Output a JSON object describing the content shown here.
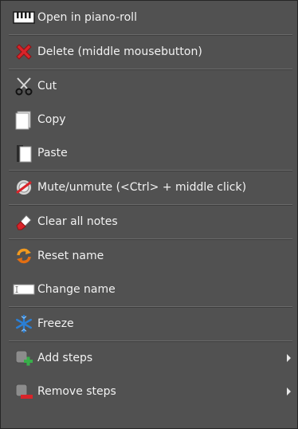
{
  "menu": {
    "items": [
      {
        "label": "Open in piano-roll",
        "icon": "piano-roll-icon"
      },
      {
        "label": "Delete (middle mousebutton)",
        "icon": "delete-x-icon"
      },
      {
        "label": "Cut",
        "icon": "scissors-icon"
      },
      {
        "label": "Copy",
        "icon": "copy-icon"
      },
      {
        "label": "Paste",
        "icon": "paste-icon"
      },
      {
        "label": "Mute/unmute (<Ctrl> + middle click)",
        "icon": "mute-icon"
      },
      {
        "label": "Clear all notes",
        "icon": "eraser-icon"
      },
      {
        "label": "Reset name",
        "icon": "reset-icon"
      },
      {
        "label": "Change name",
        "icon": "rename-field-icon"
      },
      {
        "label": "Freeze",
        "icon": "snowflake-icon"
      },
      {
        "label": "Add steps",
        "icon": "add-steps-icon",
        "submenu": true
      },
      {
        "label": "Remove steps",
        "icon": "remove-steps-icon",
        "submenu": true
      }
    ]
  },
  "colors": {
    "menu_background": "#515151",
    "text": "#f2f2f2",
    "delete_red": "#d9242a",
    "freeze_blue": "#2a7fd6",
    "add_green": "#38b04a"
  }
}
